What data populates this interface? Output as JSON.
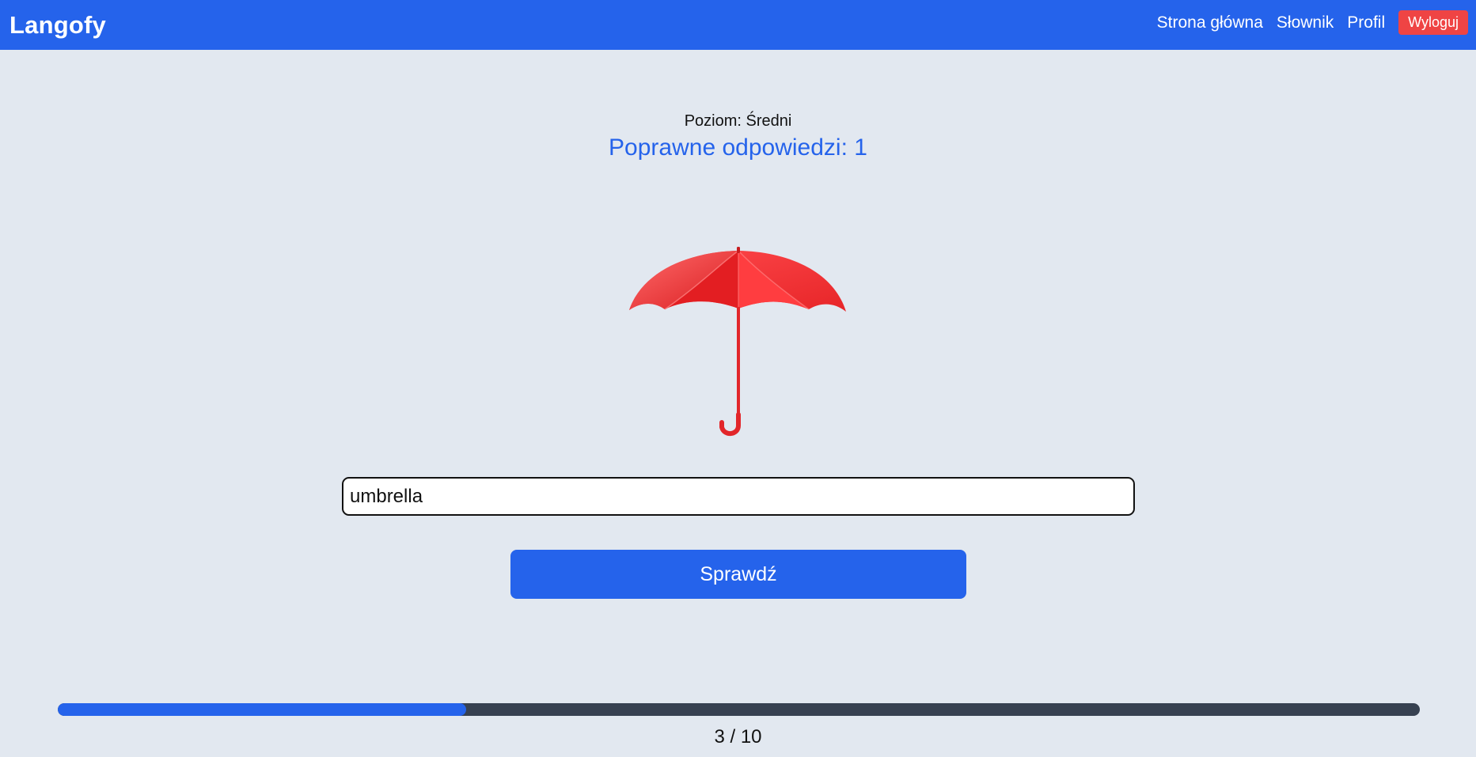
{
  "app": {
    "brand": "Langofy"
  },
  "nav": {
    "items": [
      {
        "label": "Strona główna"
      },
      {
        "label": "Słownik"
      },
      {
        "label": "Profil"
      }
    ],
    "logout_label": "Wyloguj"
  },
  "quiz": {
    "level_label": "Poziom: Średni",
    "score_label": "Poprawne odpowiedzi: 1",
    "image_icon": "umbrella-icon",
    "answer_value": "umbrella",
    "check_label": "Sprawdź",
    "progress": {
      "current": 3,
      "total": 10,
      "label": "3 / 10"
    }
  },
  "colors": {
    "primary": "#2563eb",
    "danger": "#ef4444",
    "background": "#e2e8f0",
    "track": "#374151",
    "umbrella": "#ef2b2d"
  }
}
